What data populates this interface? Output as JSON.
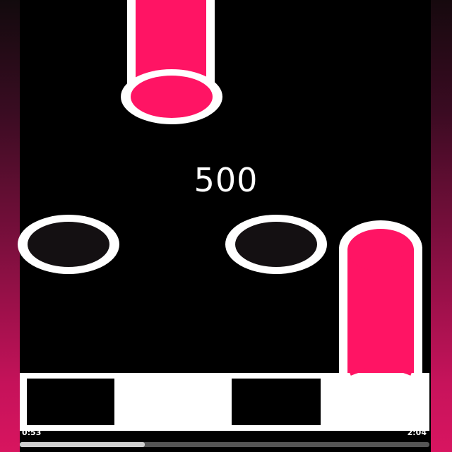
{
  "score": "500",
  "playback": {
    "elapsed": "0:53",
    "duration": "2:04",
    "progress": 0.305
  },
  "colors": {
    "note": "#ff1464",
    "outline": "#ffffff",
    "background": "#000000",
    "key_white": "#ffffff",
    "key_dark": "#000000"
  },
  "lanes": [
    {
      "key": "dark"
    },
    {
      "key": "white"
    },
    {
      "key": "dark"
    },
    {
      "key": "white"
    }
  ]
}
